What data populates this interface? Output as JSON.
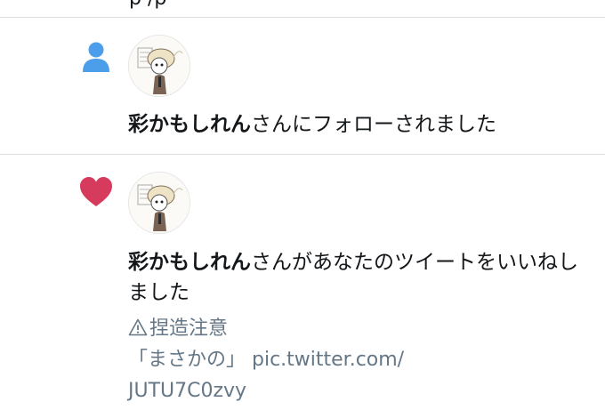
{
  "top_partial_text": "p                    /p",
  "notifications": [
    {
      "type": "follow",
      "icon": "person-icon",
      "icon_color": "#4c9eeb",
      "user_name": "彩かもしれん",
      "action_text": "さんにフォローされました"
    },
    {
      "type": "like",
      "icon": "heart-icon",
      "icon_color": "#d63a5c",
      "user_name": "彩かもしれん",
      "action_text": "さんがあなたのツイートをいいねしました",
      "tweet": {
        "warning_text": "捏造注意",
        "quote_text": "「まさかの」 pic.twitter.com/",
        "link_tail": "JUTU7C0zvy"
      }
    }
  ],
  "colors": {
    "divider": "#dcdfe2",
    "secondary_text": "#657786"
  }
}
